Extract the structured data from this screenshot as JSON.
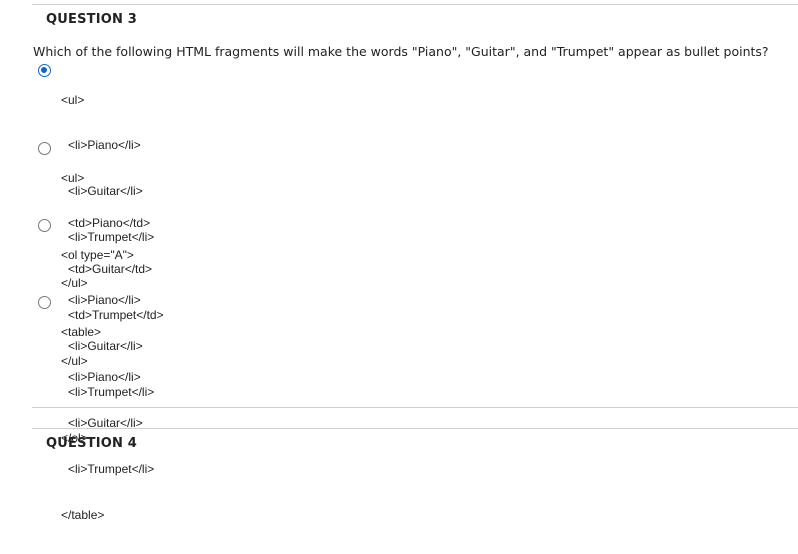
{
  "q3": {
    "heading": "QUESTION 3",
    "prompt": "Which of the following HTML fragments will make the words \"Piano\", \"Guitar\", and \"Trumpet\" appear as bullet points?",
    "options": [
      {
        "checked": true,
        "lines": [
          "<ul>",
          "<li>Piano</li>",
          "<li>Guitar</li>",
          "<li>Trumpet</li>",
          "</ul>"
        ]
      },
      {
        "checked": false,
        "lines": [
          "<ul>",
          "<td>Piano</td>",
          "<td>Guitar</td>",
          "<td>Trumpet</td>",
          "</ul>"
        ]
      },
      {
        "checked": false,
        "lines": [
          "<ol type=\"A\">",
          "<li>Piano</li>",
          "<li>Guitar</li>",
          "<li>Trumpet</li>",
          "</ol>"
        ]
      },
      {
        "checked": false,
        "lines": [
          "<table>",
          "<li>Piano</li>",
          "<li>Guitar</li>",
          "<li>Trumpet</li>",
          "</table>"
        ]
      }
    ]
  },
  "q4": {
    "heading": "QUESTION 4"
  },
  "colors": {
    "selected": "#1565c0",
    "rule": "#cfcfcf"
  }
}
